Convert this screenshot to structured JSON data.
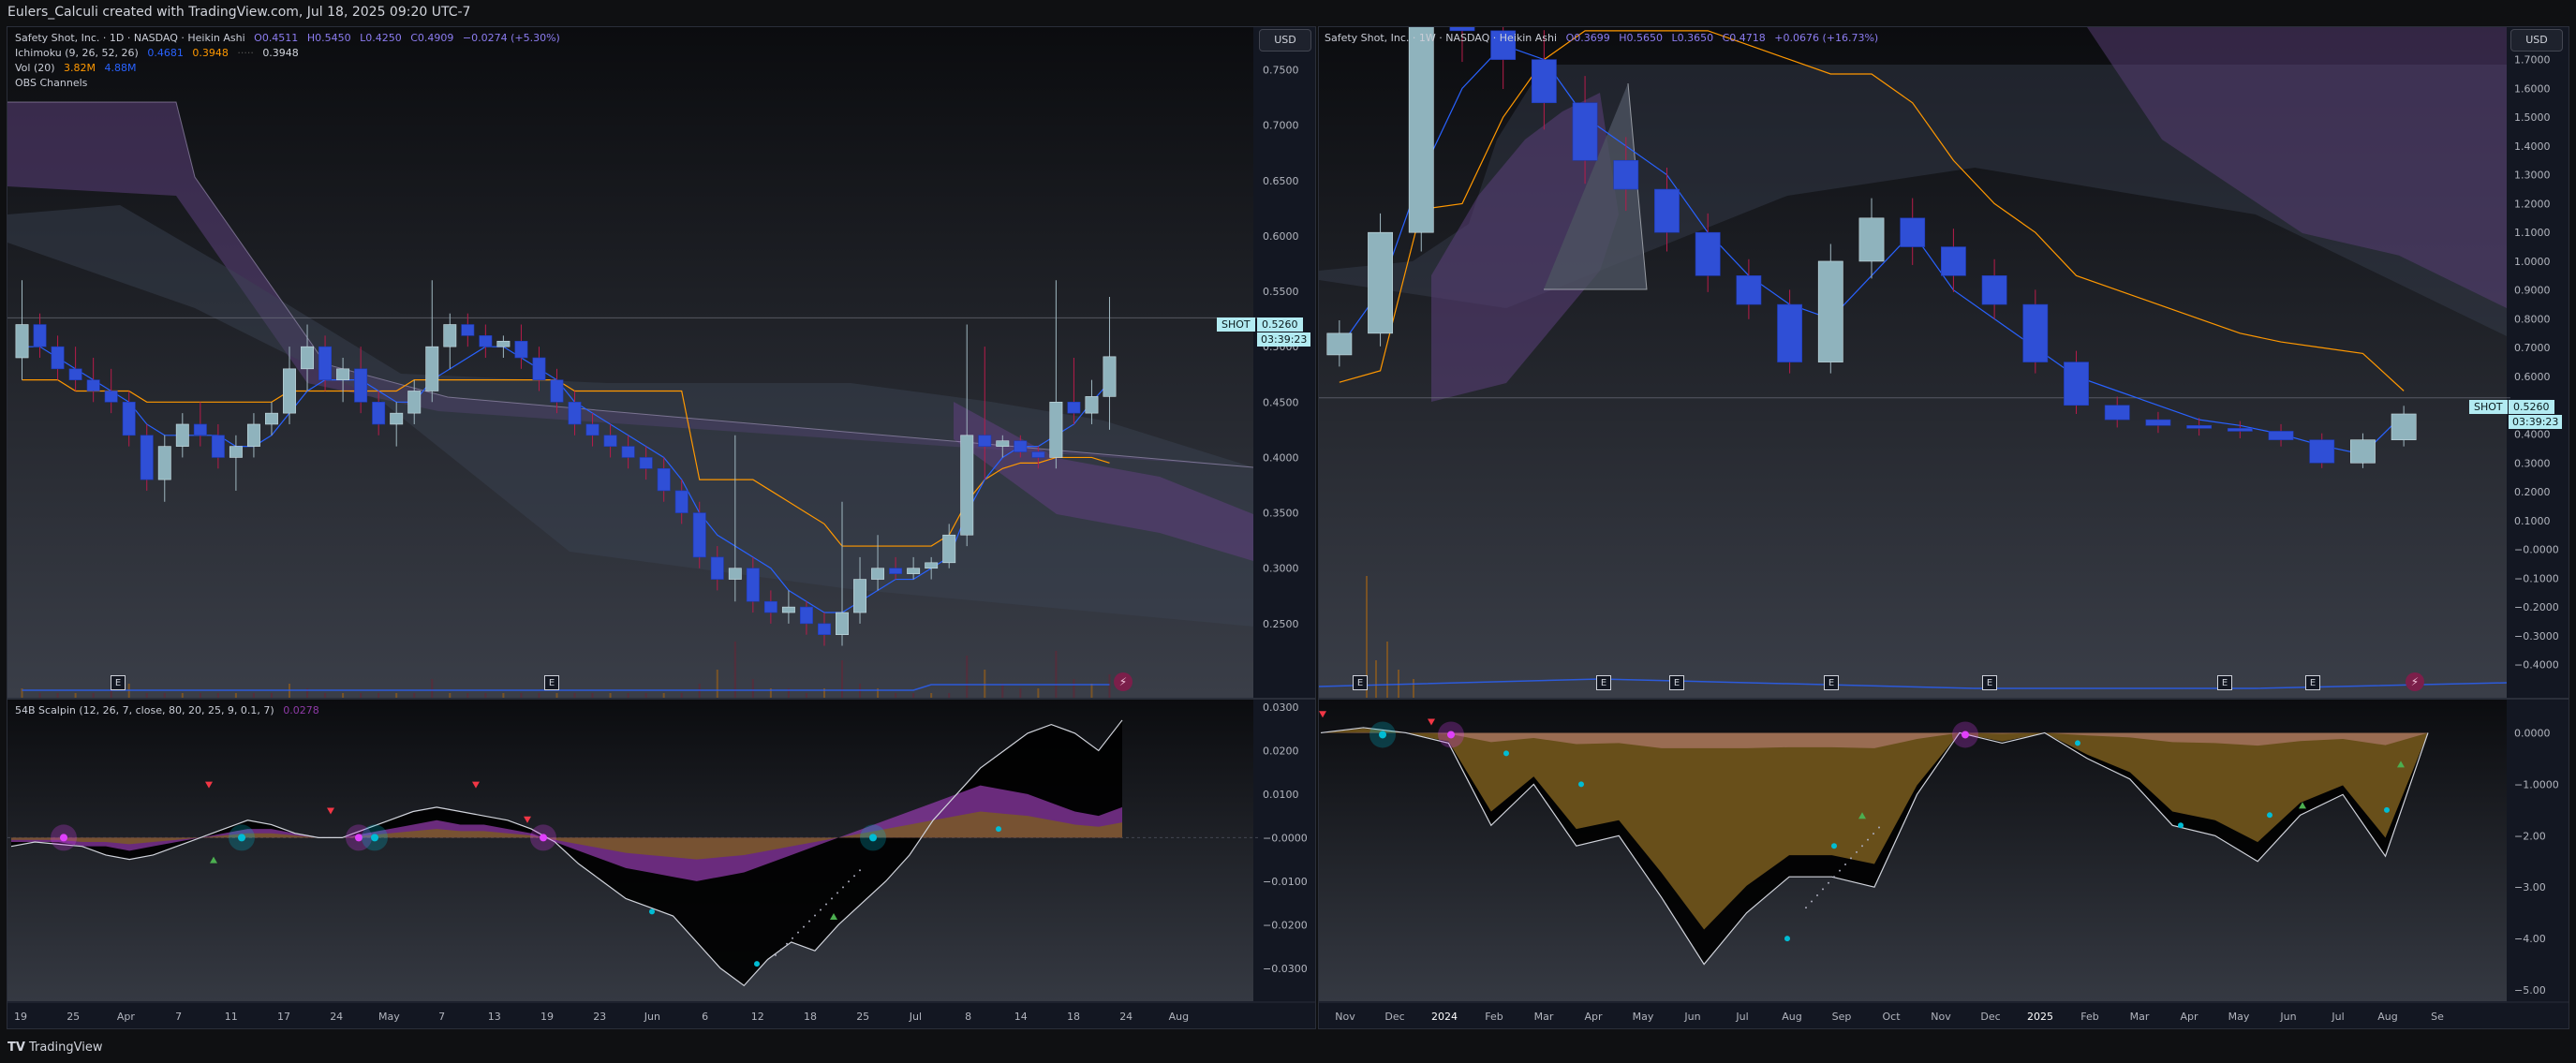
{
  "caption": "Eulers_Calculi created with TradingView.com, Jul 18, 2025 09:20 UTC-7",
  "footer": {
    "brand": "TradingView",
    "logo_text": "TV"
  },
  "colors": {
    "candle_up": "#8fb3bd",
    "candle_down": "#2f4fd6",
    "kijun": "#ff9800",
    "tenkan": "#2962ff",
    "cloud_bear": "#5b3f7a",
    "cloud_bull": "#3b4455",
    "volume": "#4a5a8a",
    "osc_purple": "#8e3aa6",
    "osc_gold": "#7a5d1f",
    "osc_pink": "#e040fb",
    "osc_cyan": "#00bcd4",
    "signal_green": "#4caf50",
    "signal_red": "#f23645"
  },
  "left": {
    "legend": {
      "title": "Safety Shot, Inc. · 1D · NASDAQ · Heikin Ashi",
      "o": "O0.4511",
      "h": "H0.5450",
      "l": "L0.4250",
      "c": "C0.4909",
      "chg": "−0.0274 (+5.30%)",
      "ichimoku": "Ichimoku (9, 26, 52, 26)",
      "ichi_v1": "0.4681",
      "ichi_v2": "0.3948",
      "ichi_v3": "0.3948",
      "vol": "Vol (20)",
      "vol_v1": "3.82M",
      "vol_v2": "4.88M",
      "obs": "OBS Channels"
    },
    "currency": "USD",
    "symbol_tag": "SHOT",
    "last_price": "0.5260",
    "countdown": "03:39:23",
    "price_axis": [
      "0.7500",
      "0.7000",
      "0.6500",
      "0.6000",
      "0.5500",
      "0.5000",
      "0.4500",
      "0.4000",
      "0.3500",
      "0.3000",
      "0.2500"
    ],
    "osc_legend": {
      "name": "54B Scalpin (12, 26, 7, close, 80, 20, 25, 9, 0.1, 7)",
      "value": "0.0278"
    },
    "osc_axis": [
      "0.0300",
      "0.0200",
      "0.0100",
      "−0.0000",
      "−0.0100",
      "−0.0200",
      "−0.0300"
    ],
    "time_axis": [
      "19",
      "25",
      "Apr",
      "7",
      "11",
      "17",
      "24",
      "May",
      "7",
      "13",
      "19",
      "23",
      "Jun",
      "6",
      "12",
      "18",
      "25",
      "Jul",
      "8",
      "14",
      "18",
      "24",
      "Aug"
    ]
  },
  "right": {
    "legend": {
      "title": "Safety Shot, Inc. · 1W · NASDAQ · Heikin Ashi",
      "o": "O0.3699",
      "h": "H0.5650",
      "l": "L0.3650",
      "c": "C0.4718",
      "chg": "+0.0676 (+16.73%)"
    },
    "currency": "USD",
    "symbol_tag": "SHOT",
    "last_price": "0.5260",
    "countdown": "03:39:23",
    "price_axis": [
      "1.7000",
      "1.6000",
      "1.5000",
      "1.4000",
      "1.3000",
      "1.2000",
      "1.1000",
      "1.0000",
      "0.9000",
      "0.8000",
      "0.7000",
      "0.6000",
      "0.5000",
      "0.4000",
      "0.3000",
      "0.2000",
      "0.1000",
      "−0.0000",
      "−0.1000",
      "−0.2000",
      "−0.3000",
      "−0.4000"
    ],
    "osc_axis": [
      "0.0000",
      "−1.0000",
      "−2.00",
      "−3.00",
      "−4.00",
      "−5.00"
    ],
    "time_axis": [
      "Nov",
      "Dec",
      "2024",
      "Feb",
      "Mar",
      "Apr",
      "May",
      "Jun",
      "Jul",
      "Aug",
      "Sep",
      "Oct",
      "Nov",
      "Dec",
      "2025",
      "Feb",
      "Mar",
      "Apr",
      "May",
      "Jun",
      "Jul",
      "Aug",
      "Se"
    ]
  },
  "chart_data": [
    {
      "type": "candlestick",
      "panel": "left-1D",
      "y_range": [
        0.2,
        0.78
      ],
      "candles": [
        [
          0.49,
          0.56,
          0.47,
          0.52
        ],
        [
          0.52,
          0.53,
          0.49,
          0.5
        ],
        [
          0.5,
          0.51,
          0.47,
          0.48
        ],
        [
          0.48,
          0.5,
          0.46,
          0.47
        ],
        [
          0.47,
          0.49,
          0.45,
          0.46
        ],
        [
          0.46,
          0.48,
          0.44,
          0.45
        ],
        [
          0.45,
          0.46,
          0.41,
          0.42
        ],
        [
          0.42,
          0.43,
          0.37,
          0.38
        ],
        [
          0.38,
          0.42,
          0.36,
          0.41
        ],
        [
          0.41,
          0.44,
          0.4,
          0.43
        ],
        [
          0.43,
          0.45,
          0.41,
          0.42
        ],
        [
          0.42,
          0.43,
          0.39,
          0.4
        ],
        [
          0.4,
          0.42,
          0.37,
          0.41
        ],
        [
          0.41,
          0.44,
          0.4,
          0.43
        ],
        [
          0.43,
          0.45,
          0.42,
          0.44
        ],
        [
          0.44,
          0.5,
          0.43,
          0.48
        ],
        [
          0.48,
          0.52,
          0.46,
          0.5
        ],
        [
          0.5,
          0.51,
          0.46,
          0.47
        ],
        [
          0.47,
          0.49,
          0.45,
          0.48
        ],
        [
          0.48,
          0.5,
          0.44,
          0.45
        ],
        [
          0.45,
          0.46,
          0.42,
          0.43
        ],
        [
          0.43,
          0.45,
          0.41,
          0.44
        ],
        [
          0.44,
          0.47,
          0.43,
          0.46
        ],
        [
          0.46,
          0.56,
          0.45,
          0.5
        ],
        [
          0.5,
          0.53,
          0.48,
          0.52
        ],
        [
          0.52,
          0.53,
          0.5,
          0.51
        ],
        [
          0.51,
          0.52,
          0.49,
          0.5
        ],
        [
          0.5,
          0.51,
          0.49,
          0.505
        ],
        [
          0.505,
          0.52,
          0.48,
          0.49
        ],
        [
          0.49,
          0.5,
          0.46,
          0.47
        ],
        [
          0.47,
          0.48,
          0.44,
          0.45
        ],
        [
          0.45,
          0.46,
          0.42,
          0.43
        ],
        [
          0.43,
          0.44,
          0.41,
          0.42
        ],
        [
          0.42,
          0.43,
          0.4,
          0.41
        ],
        [
          0.41,
          0.42,
          0.39,
          0.4
        ],
        [
          0.4,
          0.41,
          0.38,
          0.39
        ],
        [
          0.39,
          0.4,
          0.36,
          0.37
        ],
        [
          0.37,
          0.38,
          0.34,
          0.35
        ],
        [
          0.35,
          0.36,
          0.3,
          0.31
        ],
        [
          0.31,
          0.32,
          0.28,
          0.29
        ],
        [
          0.29,
          0.42,
          0.27,
          0.3
        ],
        [
          0.3,
          0.31,
          0.26,
          0.27
        ],
        [
          0.27,
          0.28,
          0.25,
          0.26
        ],
        [
          0.26,
          0.28,
          0.25,
          0.265
        ],
        [
          0.265,
          0.27,
          0.24,
          0.25
        ],
        [
          0.25,
          0.26,
          0.23,
          0.24
        ],
        [
          0.24,
          0.36,
          0.23,
          0.26
        ],
        [
          0.26,
          0.31,
          0.25,
          0.29
        ],
        [
          0.29,
          0.33,
          0.28,
          0.3
        ],
        [
          0.3,
          0.31,
          0.29,
          0.295
        ],
        [
          0.295,
          0.31,
          0.29,
          0.3
        ],
        [
          0.3,
          0.31,
          0.29,
          0.305
        ],
        [
          0.305,
          0.34,
          0.3,
          0.33
        ],
        [
          0.33,
          0.52,
          0.32,
          0.42
        ],
        [
          0.42,
          0.5,
          0.38,
          0.41
        ],
        [
          0.41,
          0.42,
          0.4,
          0.415
        ],
        [
          0.415,
          0.42,
          0.4,
          0.405
        ],
        [
          0.405,
          0.41,
          0.39,
          0.4
        ],
        [
          0.4,
          0.56,
          0.39,
          0.45
        ],
        [
          0.45,
          0.49,
          0.43,
          0.44
        ],
        [
          0.44,
          0.47,
          0.43,
          0.455
        ],
        [
          0.455,
          0.545,
          0.425,
          0.491
        ]
      ],
      "kijun": [
        0.47,
        0.47,
        0.47,
        0.46,
        0.46,
        0.46,
        0.46,
        0.45,
        0.45,
        0.45,
        0.45,
        0.45,
        0.45,
        0.45,
        0.45,
        0.46,
        0.46,
        0.46,
        0.46,
        0.46,
        0.46,
        0.46,
        0.47,
        0.47,
        0.47,
        0.47,
        0.47,
        0.47,
        0.47,
        0.47,
        0.47,
        0.46,
        0.46,
        0.46,
        0.46,
        0.46,
        0.46,
        0.46,
        0.38,
        0.38,
        0.38,
        0.38,
        0.37,
        0.36,
        0.35,
        0.34,
        0.32,
        0.32,
        0.32,
        0.32,
        0.32,
        0.32,
        0.33,
        0.36,
        0.38,
        0.39,
        0.395,
        0.395,
        0.4,
        0.4,
        0.4,
        0.395
      ],
      "tenkan": [
        0.5,
        0.5,
        0.49,
        0.48,
        0.47,
        0.46,
        0.45,
        0.43,
        0.42,
        0.42,
        0.42,
        0.42,
        0.41,
        0.41,
        0.42,
        0.44,
        0.46,
        0.47,
        0.47,
        0.47,
        0.46,
        0.45,
        0.45,
        0.47,
        0.48,
        0.49,
        0.5,
        0.5,
        0.49,
        0.48,
        0.47,
        0.45,
        0.44,
        0.43,
        0.42,
        0.41,
        0.4,
        0.38,
        0.35,
        0.33,
        0.32,
        0.31,
        0.3,
        0.28,
        0.27,
        0.26,
        0.26,
        0.27,
        0.28,
        0.29,
        0.29,
        0.3,
        0.31,
        0.35,
        0.38,
        0.4,
        0.41,
        0.41,
        0.42,
        0.43,
        0.45,
        0.468
      ],
      "volume": [
        2,
        1,
        1,
        1,
        1,
        2,
        3,
        1,
        1,
        1,
        1,
        1,
        1,
        1,
        1,
        3,
        2,
        1,
        1,
        1,
        1,
        1,
        1,
        4,
        1,
        1,
        1,
        1,
        1,
        1,
        1,
        1,
        1,
        1,
        1,
        1,
        1,
        1,
        3,
        6,
        12,
        4,
        2,
        2,
        1,
        2,
        8,
        3,
        2,
        1,
        1,
        1,
        1,
        9,
        6,
        3,
        2,
        2,
        10,
        4,
        3,
        5
      ]
    },
    {
      "type": "oscillator",
      "panel": "left-1D",
      "y_range": [
        -0.035,
        0.03
      ],
      "main": [
        -0.002,
        -0.001,
        -0.0015,
        -0.002,
        -0.004,
        -0.005,
        -0.004,
        -0.002,
        0.0,
        0.002,
        0.004,
        0.003,
        0.001,
        0.0,
        0.0,
        0.002,
        0.004,
        0.006,
        0.007,
        0.006,
        0.005,
        0.004,
        0.002,
        -0.001,
        -0.006,
        -0.01,
        -0.014,
        -0.016,
        -0.018,
        -0.024,
        -0.03,
        -0.034,
        -0.028,
        -0.024,
        -0.026,
        -0.02,
        -0.015,
        -0.01,
        -0.004,
        0.004,
        0.01,
        0.016,
        0.02,
        0.024,
        0.026,
        0.024,
        0.02,
        0.027
      ],
      "secondary": [
        -0.001,
        -0.001,
        -0.001,
        -0.002,
        -0.002,
        -0.003,
        -0.002,
        -0.001,
        0.0,
        0.001,
        0.002,
        0.002,
        0.001,
        0.0,
        0.0,
        0.001,
        0.002,
        0.003,
        0.004,
        0.003,
        0.003,
        0.002,
        0.001,
        -0.001,
        -0.003,
        -0.005,
        -0.007,
        -0.008,
        -0.009,
        -0.01,
        -0.009,
        -0.008,
        -0.006,
        -0.004,
        -0.002,
        0.0,
        0.002,
        0.004,
        0.006,
        0.008,
        0.01,
        0.012,
        0.011,
        0.01,
        0.008,
        0.006,
        0.005,
        0.007
      ]
    },
    {
      "type": "candlestick",
      "panel": "right-1W",
      "y_range": [
        -0.45,
        1.78
      ],
      "kijun": [
        0.58,
        0.62,
        1.18,
        1.2,
        1.5,
        1.7,
        1.8,
        1.8,
        1.8,
        1.8,
        1.75,
        1.7,
        1.65,
        1.65,
        1.55,
        1.35,
        1.2,
        1.1,
        0.95,
        0.9,
        0.85,
        0.8,
        0.75,
        0.72,
        0.7,
        0.68,
        0.55
      ],
      "tenkan": [
        0.7,
        0.9,
        1.3,
        1.6,
        1.75,
        1.7,
        1.5,
        1.4,
        1.3,
        1.1,
        0.95,
        0.85,
        0.8,
        0.95,
        1.1,
        0.9,
        0.8,
        0.7,
        0.6,
        0.55,
        0.5,
        0.45,
        0.43,
        0.4,
        0.36,
        0.33,
        0.47
      ],
      "close": [
        0.75,
        1.1,
        1.9,
        1.8,
        1.7,
        1.55,
        1.35,
        1.25,
        1.1,
        0.95,
        0.85,
        0.65,
        1.0,
        1.15,
        1.05,
        0.95,
        0.85,
        0.65,
        0.5,
        0.45,
        0.43,
        0.42,
        0.41,
        0.38,
        0.3,
        0.38,
        0.47
      ]
    },
    {
      "type": "oscillator",
      "panel": "right-1W",
      "y_range": [
        -5.0,
        0.5
      ],
      "main": [
        0.0,
        0.1,
        0.0,
        -0.2,
        -1.8,
        -1.0,
        -2.2,
        -2.0,
        -3.2,
        -4.5,
        -3.5,
        -2.8,
        -2.8,
        -3.0,
        -1.2,
        0.0,
        -0.2,
        0.0,
        -0.5,
        -0.9,
        -1.8,
        -2.0,
        -2.5,
        -1.6,
        -1.2,
        -2.4,
        0.0
      ]
    }
  ]
}
